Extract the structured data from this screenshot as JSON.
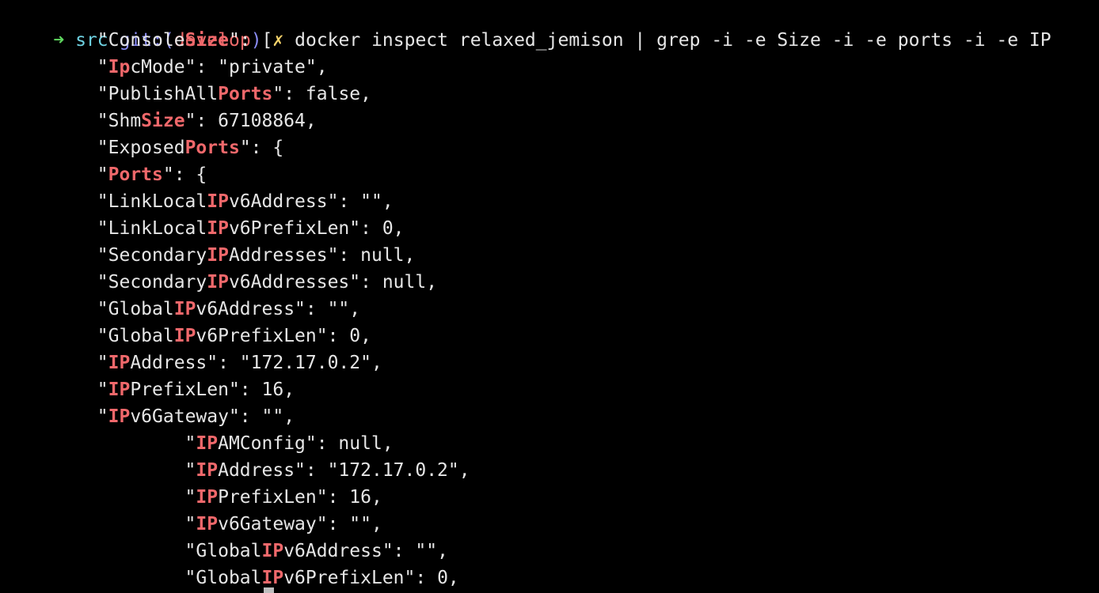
{
  "prompt": {
    "arrow": "➜",
    "dir": "src",
    "git_label": "git:(",
    "branch": "develop",
    "git_close": ")",
    "dirty_mark": "✗",
    "command": "docker inspect relaxed_jemison | grep -i -e Size -i -e ports -i -e IP"
  },
  "output_lines": [
    [
      {
        "t": "        \"Console"
      },
      {
        "t": "Size",
        "hl": true
      },
      {
        "t": "\": ["
      }
    ],
    [
      {
        "t": "        \""
      },
      {
        "t": "Ip",
        "hl": true
      },
      {
        "t": "cMode\": \"private\","
      }
    ],
    [
      {
        "t": "        \"PublishAll"
      },
      {
        "t": "Ports",
        "hl": true
      },
      {
        "t": "\": false,"
      }
    ],
    [
      {
        "t": "        \"Shm"
      },
      {
        "t": "Size",
        "hl": true
      },
      {
        "t": "\": 67108864,"
      }
    ],
    [
      {
        "t": "        \"Exposed"
      },
      {
        "t": "Ports",
        "hl": true
      },
      {
        "t": "\": {"
      }
    ],
    [
      {
        "t": "        \""
      },
      {
        "t": "Ports",
        "hl": true
      },
      {
        "t": "\": {"
      }
    ],
    [
      {
        "t": "        \"LinkLocal"
      },
      {
        "t": "IP",
        "hl": true
      },
      {
        "t": "v6Address\": \"\","
      }
    ],
    [
      {
        "t": "        \"LinkLocal"
      },
      {
        "t": "IP",
        "hl": true
      },
      {
        "t": "v6PrefixLen\": 0,"
      }
    ],
    [
      {
        "t": "        \"Secondary"
      },
      {
        "t": "IP",
        "hl": true
      },
      {
        "t": "Addresses\": null,"
      }
    ],
    [
      {
        "t": "        \"Secondary"
      },
      {
        "t": "IP",
        "hl": true
      },
      {
        "t": "v6Addresses\": null,"
      }
    ],
    [
      {
        "t": "        \"Global"
      },
      {
        "t": "IP",
        "hl": true
      },
      {
        "t": "v6Address\": \"\","
      }
    ],
    [
      {
        "t": "        \"Global"
      },
      {
        "t": "IP",
        "hl": true
      },
      {
        "t": "v6PrefixLen\": 0,"
      }
    ],
    [
      {
        "t": "        \""
      },
      {
        "t": "IP",
        "hl": true
      },
      {
        "t": "Address\": \"172.17.0.2\","
      }
    ],
    [
      {
        "t": "        \""
      },
      {
        "t": "IP",
        "hl": true
      },
      {
        "t": "PrefixLen\": 16,"
      }
    ],
    [
      {
        "t": "        \""
      },
      {
        "t": "IP",
        "hl": true
      },
      {
        "t": "v6Gateway\": \"\","
      }
    ],
    [
      {
        "t": "                \""
      },
      {
        "t": "IP",
        "hl": true
      },
      {
        "t": "AMConfig\": null,"
      }
    ],
    [
      {
        "t": "                \""
      },
      {
        "t": "IP",
        "hl": true
      },
      {
        "t": "Address\": \"172.17.0.2\","
      }
    ],
    [
      {
        "t": "                \""
      },
      {
        "t": "IP",
        "hl": true
      },
      {
        "t": "PrefixLen\": 16,"
      }
    ],
    [
      {
        "t": "                \""
      },
      {
        "t": "IP",
        "hl": true
      },
      {
        "t": "v6Gateway\": \"\","
      }
    ],
    [
      {
        "t": "                \"Global"
      },
      {
        "t": "IP",
        "hl": true
      },
      {
        "t": "v6Address\": \"\","
      }
    ],
    [
      {
        "t": "                \"Global"
      },
      {
        "t": "IP",
        "hl": true
      },
      {
        "t": "v6PrefixLen\": 0,"
      }
    ]
  ],
  "colors": {
    "background": "#000000",
    "text": "#e6e6e6",
    "highlight": "#f0686b",
    "arrow": "#5fd75f",
    "dir": "#6fd3e3",
    "git": "#8a8cf5",
    "branch": "#ee6a6a",
    "dirty_mark": "#f5d36b"
  }
}
